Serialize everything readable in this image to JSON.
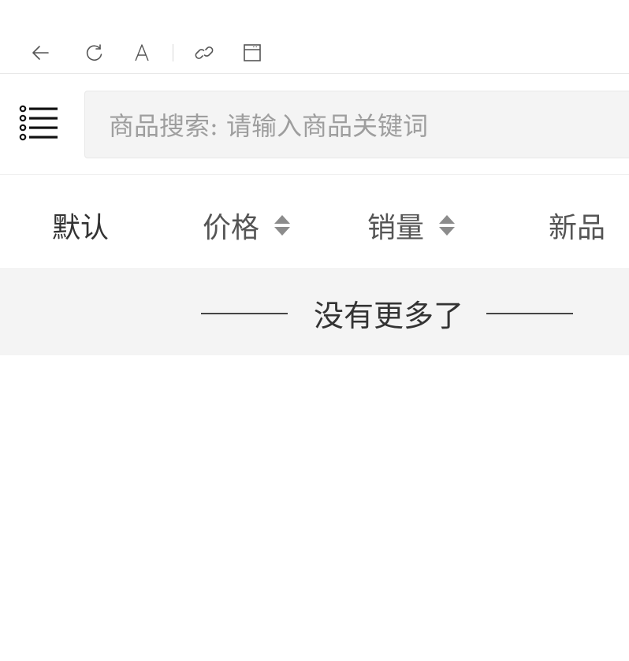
{
  "toolbar": {
    "icons": [
      "back-arrow-icon",
      "refresh-icon",
      "font-size-icon",
      "link-icon",
      "window-icon"
    ]
  },
  "search": {
    "menu_icon": "list-menu-icon",
    "placeholder": "商品搜索: 请输入商品关键词"
  },
  "sort_tabs": [
    {
      "label": "默认",
      "active": true
    },
    {
      "label": "价格",
      "sortable": true
    },
    {
      "label": "销量",
      "sortable": true
    },
    {
      "label": "新品"
    }
  ],
  "list_status": {
    "text": "没有更多了"
  }
}
